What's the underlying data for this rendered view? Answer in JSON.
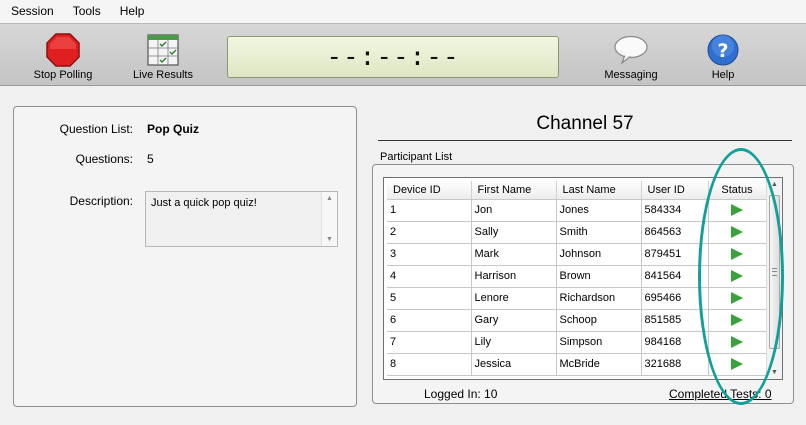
{
  "menu": [
    "Session",
    "Tools",
    "Help"
  ],
  "toolbar": {
    "stop_polling": "Stop Polling",
    "live_results": "Live Results",
    "timer": "--:--:--",
    "messaging": "Messaging",
    "help": "Help"
  },
  "quiz": {
    "question_list_label": "Question List:",
    "question_list_value": "Pop Quiz",
    "questions_label": "Questions:",
    "questions_value": "5",
    "description_label": "Description:",
    "description_value": "Just a quick pop quiz!"
  },
  "channel": {
    "title": "Channel 57"
  },
  "participants": {
    "label": "Participant List",
    "columns": [
      "Device ID",
      "First Name",
      "Last Name",
      "User ID",
      "Status"
    ],
    "rows": [
      [
        "1",
        "Jon",
        "Jones",
        "584334"
      ],
      [
        "2",
        "Sally",
        "Smith",
        "864563"
      ],
      [
        "3",
        "Mark",
        "Johnson",
        "879451"
      ],
      [
        "4",
        "Harrison",
        "Brown",
        "841564"
      ],
      [
        "5",
        "Lenore",
        "Richardson",
        "695466"
      ],
      [
        "6",
        "Gary",
        "Schoop",
        "851585"
      ],
      [
        "7",
        "Lily",
        "Simpson",
        "984168"
      ],
      [
        "8",
        "Jessica",
        "McBride",
        "321688"
      ]
    ]
  },
  "footer": {
    "logged_in": "Logged In: 10",
    "completed_tests": "Completed Tests:  0"
  },
  "icons": {
    "stop": "stop-octagon-icon",
    "live_results": "grid-checkmarks-icon",
    "messaging": "speech-bubble-icon",
    "help": "question-circle-icon",
    "status": "play-triangle-icon"
  },
  "colors": {
    "stop_red": "#e02020",
    "status_green": "#3aa23a",
    "annotation_teal": "#12a09a",
    "help_blue": "#2f6fd0"
  }
}
